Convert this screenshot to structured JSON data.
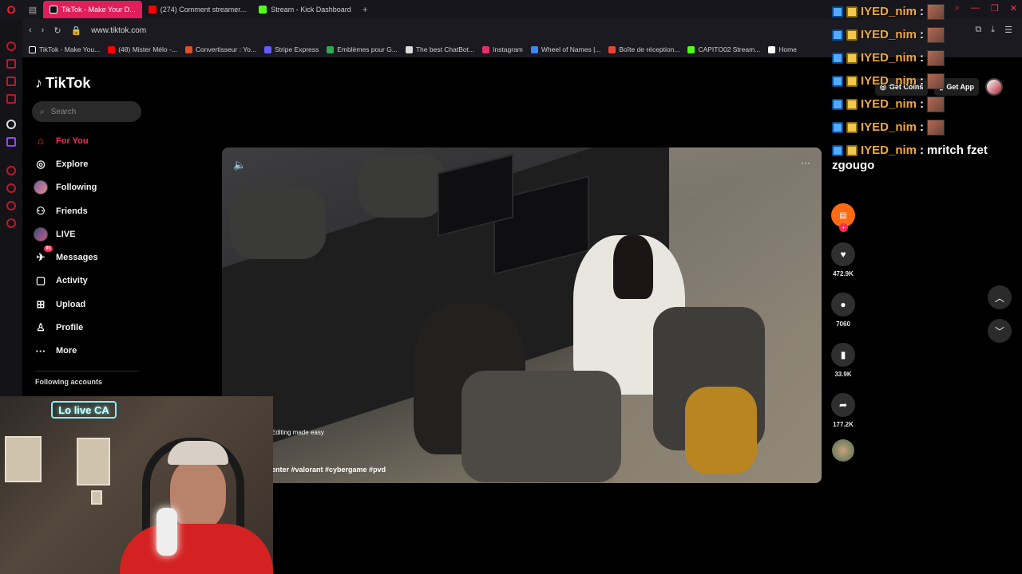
{
  "browser": {
    "tabs": [
      {
        "label": "TikTok - Make Your D...",
        "active": true,
        "color": "#111111"
      },
      {
        "label": "(274) Comment streamer...",
        "active": false,
        "color": "#ff0000"
      },
      {
        "label": "Stream - Kick Dashboard",
        "active": false,
        "color": "#53fc18"
      }
    ],
    "url": "www.tiktok.com",
    "bookmarks": [
      {
        "label": "TikTok - Make You...",
        "color": "#111111"
      },
      {
        "label": "(48) Mister Mélo -...",
        "color": "#ff0000"
      },
      {
        "label": "Convertisseur : Yo...",
        "color": "#e44d26"
      },
      {
        "label": "Stripe Express",
        "color": "#635bff"
      },
      {
        "label": "Emblèmes pour G...",
        "color": "#34a853"
      },
      {
        "label": "The best ChatBot...",
        "color": "#dddddd"
      },
      {
        "label": "Instagram",
        "color": "#e1306c"
      },
      {
        "label": "Wheel of Names |...",
        "color": "#4285f4"
      },
      {
        "label": "Boîte de réception...",
        "color": "#ea4335"
      },
      {
        "label": "CAPITO02 Stream...",
        "color": "#53fc18"
      },
      {
        "label": "Home",
        "color": "#ffffff"
      }
    ]
  },
  "tiktok": {
    "logo": "TikTok",
    "search_placeholder": "Search",
    "nav": [
      {
        "label": "For You",
        "icon": "home-icon",
        "active": true
      },
      {
        "label": "Explore",
        "icon": "compass-icon",
        "active": false
      },
      {
        "label": "Following",
        "icon": "avatar-icon",
        "active": false
      },
      {
        "label": "Friends",
        "icon": "friends-icon",
        "active": false
      },
      {
        "label": "LIVE",
        "icon": "live-icon",
        "active": false
      },
      {
        "label": "Messages",
        "icon": "messages-icon",
        "active": false,
        "badge": "91"
      },
      {
        "label": "Activity",
        "icon": "activity-icon",
        "active": false
      },
      {
        "label": "Upload",
        "icon": "upload-icon",
        "active": false
      },
      {
        "label": "Profile",
        "icon": "profile-icon",
        "active": false
      },
      {
        "label": "More",
        "icon": "more-icon",
        "active": false
      }
    ],
    "following_accounts": "Following accounts",
    "get_coins": "Get Coins",
    "get_app": "Get App",
    "video": {
      "caption_top": "Editing made easy",
      "caption": "enter #valorant #cybergame #pvd"
    },
    "actions": [
      {
        "icon": "heart-icon",
        "count": "472.9K"
      },
      {
        "icon": "comment-icon",
        "count": "7060"
      },
      {
        "icon": "bookmark-icon",
        "count": "33.9K"
      },
      {
        "icon": "share-icon",
        "count": "177.2K"
      }
    ]
  },
  "overlay": {
    "neon_sign": "Lo live CA",
    "chat": [
      {
        "user": "IYED_nim",
        "msg": ""
      },
      {
        "user": "IYED_nim",
        "msg": ""
      },
      {
        "user": "IYED_nim",
        "msg": ""
      },
      {
        "user": "IYED_nim",
        "msg": ""
      },
      {
        "user": "IYED_nim",
        "msg": ""
      },
      {
        "user": "IYED_nim",
        "msg": ""
      },
      {
        "user": "IYED_nim",
        "msg": "mritch fzet"
      }
    ],
    "chat_tail": "zgougo",
    "separator": ":"
  }
}
